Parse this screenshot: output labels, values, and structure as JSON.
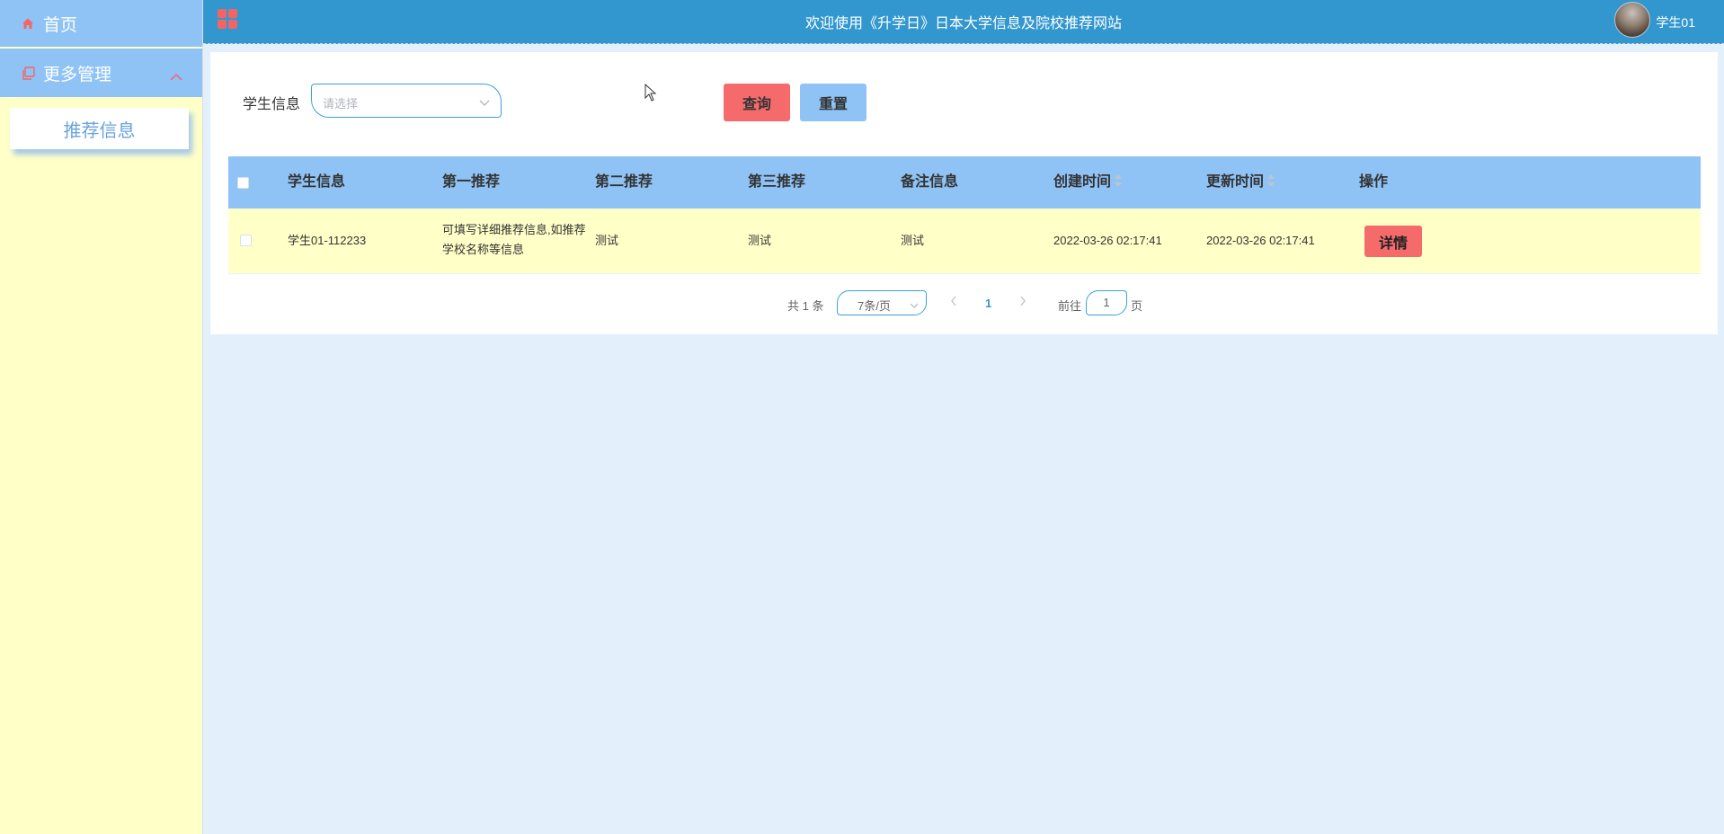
{
  "sidebar": {
    "home_label": "首页",
    "more_label": "更多管理",
    "sub_items": [
      {
        "label": "推荐信息"
      }
    ]
  },
  "header": {
    "title": "欢迎使用《升学日》日本大学信息及院校推荐网站",
    "username": "学生01"
  },
  "search": {
    "label": "学生信息",
    "placeholder": "请选择",
    "query_label": "查询",
    "reset_label": "重置"
  },
  "table": {
    "columns": [
      "学生信息",
      "第一推荐",
      "第二推荐",
      "第三推荐",
      "备注信息",
      "创建时间",
      "更新时间",
      "操作"
    ],
    "rows": [
      {
        "student": "学生01-112233",
        "first": "可填写详细推荐信息,如推荐学校名称等信息",
        "second": "测试",
        "third": "测试",
        "remark": "测试",
        "created": "2022-03-26 02:17:41",
        "updated": "2022-03-26 02:17:41",
        "action": "详情"
      }
    ]
  },
  "pagination": {
    "total": "共 1 条",
    "page_size": "7条/页",
    "current": "1",
    "goto_prefix": "前往",
    "goto_value": "1",
    "goto_suffix": "页"
  },
  "colors": {
    "header": "#3397cf",
    "sidebar_item": "#8fc3f5",
    "sidebar_bg": "#ffffc8",
    "accent_red": "#f56b6b",
    "table_row": "#ffffc8"
  }
}
